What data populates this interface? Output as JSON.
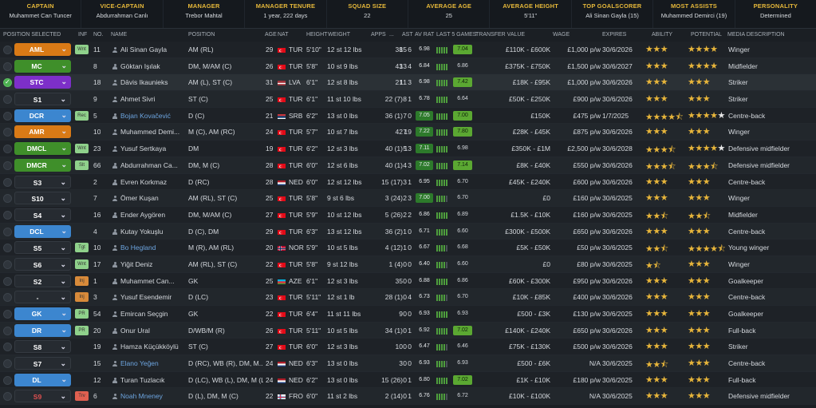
{
  "header": [
    {
      "label": "CAPTAIN",
      "value": "Muhammet Can Tuncer"
    },
    {
      "label": "VICE-CAPTAIN",
      "value": "Abdurrahman Canlı"
    },
    {
      "label": "MANAGER",
      "value": "Trebor Mahtal"
    },
    {
      "label": "MANAGER TENURE",
      "value": "1 year, 222 days"
    },
    {
      "label": "SQUAD SIZE",
      "value": "22"
    },
    {
      "label": "AVERAGE AGE",
      "value": "25"
    },
    {
      "label": "AVERAGE HEIGHT",
      "value": "5'11\""
    },
    {
      "label": "TOP GOALSCORER",
      "value": "Ali Sinan Gayla (15)"
    },
    {
      "label": "MOST ASSISTS",
      "value": "Muhammed Demirci (19)"
    },
    {
      "label": "PERSONALITY",
      "value": "Determined"
    }
  ],
  "columns": {
    "position_selected": "POSITION SELECTED",
    "inf": "INF",
    "no": "NO.",
    "name": "NAME",
    "position": "POSITION",
    "age": "AGE",
    "nat": "NAT",
    "height": "HEIGHT",
    "weight": "WEIGHT",
    "apps": "APPS",
    "gls": "...",
    "ast": "AST",
    "av_rat": "AV RAT",
    "last5": "LAST 5 GAMES",
    "transfer_value": "TRANSFER VALUE",
    "wage": "WAGE",
    "expires": "EXPIRES",
    "ability": "ABILITY",
    "potential": "POTENTIAL",
    "media": "MEDIA DESCRIPTION"
  },
  "colors": {
    "orange": "#d97a16",
    "green": "#3f8f2a",
    "purple": "#7d2fc9",
    "blue": "#3c86cf",
    "gray": "#262b31",
    "star": "#e7b53b"
  },
  "players": [
    {
      "sel": "AML",
      "pc": "orange",
      "inf": "Wnt",
      "infc": "#8fd18b",
      "no": "11",
      "name": "Ali Sinan Gayla",
      "blue": false,
      "pos": "AM (RL)",
      "age": "29",
      "flag": "tr",
      "nat": "TUR",
      "h": "5'10\"",
      "w": "12 st 12 lbs",
      "apps": "38",
      "gls": "15",
      "ast": "6",
      "avr": "6.98",
      "avg": false,
      "bars": 5,
      "l5": "7.04",
      "l5g": true,
      "tv": "£110K - £600K",
      "wage": "£1,000 p/w",
      "exp": "30/6/2026",
      "ab": 3,
      "abh": 0,
      "po": 4,
      "poh": 0,
      "pow": 0,
      "media": "Winger",
      "check": false
    },
    {
      "sel": "MC",
      "pc": "green",
      "inf": "",
      "infc": "",
      "no": "8",
      "name": "Göktan Işılak",
      "blue": false,
      "pos": "DM, M/AM (C)",
      "age": "26",
      "flag": "tr",
      "nat": "TUR",
      "h": "5'8\"",
      "w": "10 st 9 lbs",
      "apps": "43",
      "gls": "13",
      "ast": "4",
      "avr": "6.84",
      "avg": false,
      "bars": 5,
      "l5": "6.86",
      "l5g": false,
      "tv": "£375K - £750K",
      "wage": "£1,500 p/w",
      "exp": "30/6/2027",
      "ab": 3,
      "abh": 0,
      "po": 4,
      "poh": 0,
      "pow": 0,
      "media": "Midfielder",
      "check": false
    },
    {
      "sel": "STC",
      "pc": "purple",
      "inf": "",
      "infc": "",
      "no": "18",
      "name": "Dāvis Ikaunieks",
      "blue": false,
      "pos": "AM (L), ST (C)",
      "age": "31",
      "flag": "lv",
      "nat": "LVA",
      "h": "6'1\"",
      "w": "12 st 8 lbs",
      "apps": "21",
      "gls": "11",
      "ast": "3",
      "avr": "6.98",
      "avg": false,
      "bars": 5,
      "l5": "7.42",
      "l5g": true,
      "tv": "£18K - £95K",
      "wage": "£1,000 p/w",
      "exp": "30/6/2026",
      "ab": 3,
      "abh": 0,
      "po": 3,
      "poh": 0,
      "pow": 0,
      "media": "Striker",
      "check": true
    },
    {
      "sel": "S1",
      "pc": "gray",
      "inf": "",
      "infc": "",
      "no": "9",
      "name": "Ahmet Sivri",
      "blue": false,
      "pos": "ST (C)",
      "age": "25",
      "flag": "tr",
      "nat": "TUR",
      "h": "6'1\"",
      "w": "11 st 10 lbs",
      "apps": "22 (7)",
      "gls": "8",
      "ast": "1",
      "avr": "6.78",
      "avg": false,
      "bars": 5,
      "l5": "6.64",
      "l5g": false,
      "tv": "£50K - £250K",
      "wage": "£900 p/w",
      "exp": "30/6/2026",
      "ab": 3,
      "abh": 0,
      "po": 3,
      "poh": 0,
      "pow": 0,
      "media": "Striker",
      "check": false
    },
    {
      "sel": "DCR",
      "pc": "blue",
      "inf": "Rec",
      "infc": "#8fd18b",
      "no": "5",
      "name": "Bojan Kovačević",
      "blue": true,
      "pos": "D (C)",
      "age": "21",
      "flag": "rs",
      "nat": "SRB",
      "h": "6'2\"",
      "w": "13 st 0 lbs",
      "apps": "36 (1)",
      "gls": "7",
      "ast": "0",
      "avr": "7.05",
      "avg": true,
      "bars": 5,
      "l5": "7.00",
      "l5g": true,
      "tv": "£150K",
      "wage": "£475 p/w",
      "exp": "1/7/2025",
      "ab": 4,
      "abh": 1,
      "po": 4,
      "poh": 0,
      "pow": 1,
      "media": "Centre-back",
      "check": false
    },
    {
      "sel": "AMR",
      "pc": "orange",
      "inf": "",
      "infc": "",
      "no": "10",
      "name": "Muhammed Demi...",
      "blue": false,
      "pos": "M (C), AM (RC)",
      "age": "24",
      "flag": "tr",
      "nat": "TUR",
      "h": "5'7\"",
      "w": "10 st 7 lbs",
      "apps": "42",
      "gls": "7",
      "ast": "19",
      "avr": "7.22",
      "avg": true,
      "bars": 5,
      "l5": "7.80",
      "l5g": true,
      "tv": "£28K - £45K",
      "wage": "£875 p/w",
      "exp": "30/6/2026",
      "ab": 3,
      "abh": 0,
      "po": 3,
      "poh": 0,
      "pow": 0,
      "media": "Winger",
      "check": false
    },
    {
      "sel": "DMCL",
      "pc": "green",
      "inf": "Wnt",
      "infc": "#8fd18b",
      "no": "23",
      "name": "Yusuf Sertkaya",
      "blue": false,
      "pos": "DM",
      "age": "19",
      "flag": "tr",
      "nat": "TUR",
      "h": "6'2\"",
      "w": "12 st 3 lbs",
      "apps": "40 (1)",
      "gls": "5",
      "ast": "13",
      "avr": "7.11",
      "avg": true,
      "bars": 5,
      "l5": "6.98",
      "l5g": false,
      "tv": "£350K - £1M",
      "wage": "£2,500 p/w",
      "exp": "30/6/2028",
      "ab": 3,
      "abh": 1,
      "po": 4,
      "poh": 0,
      "pow": 1,
      "media": "Defensive midfielder",
      "check": false
    },
    {
      "sel": "DMCR",
      "pc": "green",
      "inf": "Slt",
      "infc": "#8fd18b",
      "no": "66",
      "name": "Abdurrahman Ca...",
      "blue": false,
      "pos": "DM, M (C)",
      "age": "28",
      "flag": "tr",
      "nat": "TUR",
      "h": "6'0\"",
      "w": "12 st 6 lbs",
      "apps": "40 (1)",
      "gls": "4",
      "ast": "3",
      "avr": "7.02",
      "avg": true,
      "bars": 5,
      "l5": "7.14",
      "l5g": true,
      "tv": "£8K - £40K",
      "wage": "£550 p/w",
      "exp": "30/6/2026",
      "ab": 3,
      "abh": 1,
      "po": 3,
      "poh": 1,
      "pow": 0,
      "media": "Defensive midfielder",
      "check": false
    },
    {
      "sel": "S3",
      "pc": "gray",
      "inf": "",
      "infc": "",
      "no": "2",
      "name": "Evren Korkmaz",
      "blue": false,
      "pos": "D (RC)",
      "age": "28",
      "flag": "nl",
      "nat": "NED",
      "h": "6'0\"",
      "w": "12 st 12 lbs",
      "apps": "15 (17)",
      "gls": "3",
      "ast": "1",
      "avr": "6.95",
      "avg": false,
      "bars": 5,
      "l5": "6.70",
      "l5g": false,
      "tv": "£45K - £240K",
      "wage": "£600 p/w",
      "exp": "30/6/2026",
      "ab": 3,
      "abh": 0,
      "po": 3,
      "poh": 0,
      "pow": 0,
      "media": "Centre-back",
      "check": false
    },
    {
      "sel": "S10",
      "pc": "gray",
      "inf": "",
      "infc": "",
      "no": "7",
      "name": "Ömer Kuşan",
      "blue": false,
      "pos": "AM (RL), ST (C)",
      "age": "25",
      "flag": "tr",
      "nat": "TUR",
      "h": "5'8\"",
      "w": "9 st 6 lbs",
      "apps": "3 (24)",
      "gls": "2",
      "ast": "3",
      "avr": "7.00",
      "avg": true,
      "bars": 4,
      "l5": "6.70",
      "l5g": false,
      "tv": "£0",
      "wage": "£160 p/w",
      "exp": "30/6/2025",
      "ab": 3,
      "abh": 0,
      "po": 3,
      "poh": 0,
      "pow": 0,
      "media": "Winger",
      "check": false
    },
    {
      "sel": "S4",
      "pc": "gray",
      "inf": "",
      "infc": "",
      "no": "16",
      "name": "Ender Aygören",
      "blue": false,
      "pos": "DM, M/AM (C)",
      "age": "27",
      "flag": "tr",
      "nat": "TUR",
      "h": "5'9\"",
      "w": "10 st 12 lbs",
      "apps": "5 (26)",
      "gls": "2",
      "ast": "2",
      "avr": "6.86",
      "avg": false,
      "bars": 5,
      "l5": "6.89",
      "l5g": false,
      "tv": "£1.5K - £10K",
      "wage": "£160 p/w",
      "exp": "30/6/2025",
      "ab": 2,
      "abh": 1,
      "po": 2,
      "poh": 1,
      "pow": 0,
      "media": "Midfielder",
      "check": false
    },
    {
      "sel": "DCL",
      "pc": "blue",
      "inf": "",
      "infc": "",
      "no": "4",
      "name": "Kutay Yokuşlu",
      "blue": false,
      "pos": "D (C), DM",
      "age": "29",
      "flag": "tr",
      "nat": "TUR",
      "h": "6'3\"",
      "w": "13 st 12 lbs",
      "apps": "36 (2)",
      "gls": "1",
      "ast": "0",
      "avr": "6.71",
      "avg": false,
      "bars": 5,
      "l5": "6.60",
      "l5g": false,
      "tv": "£300K - £500K",
      "wage": "£650 p/w",
      "exp": "30/6/2026",
      "ab": 3,
      "abh": 0,
      "po": 3,
      "poh": 0,
      "pow": 0,
      "media": "Centre-back",
      "check": false
    },
    {
      "sel": "S5",
      "pc": "gray",
      "inf": "Tgt",
      "infc": "#8fd18b",
      "no": "10",
      "name": "Bo Hegland",
      "blue": true,
      "pos": "M (R), AM (RL)",
      "age": "20",
      "flag": "no",
      "nat": "NOR",
      "h": "5'9\"",
      "w": "10 st 5 lbs",
      "apps": "4 (12)",
      "gls": "1",
      "ast": "0",
      "avr": "6.67",
      "avg": false,
      "bars": 4,
      "l5": "6.68",
      "l5g": false,
      "tv": "£5K - £50K",
      "wage": "£50 p/w",
      "exp": "30/6/2025",
      "ab": 2,
      "abh": 1,
      "po": 4,
      "poh": 1,
      "pow": 0,
      "media": "Young winger",
      "check": false
    },
    {
      "sel": "S6",
      "pc": "gray",
      "inf": "Wnt",
      "infc": "#8fd18b",
      "no": "17",
      "name": "Yiğit Deniz",
      "blue": false,
      "pos": "AM (RL), ST (C)",
      "age": "22",
      "flag": "tr",
      "nat": "TUR",
      "h": "5'8\"",
      "w": "9 st 12 lbs",
      "apps": "1 (4)",
      "gls": "0",
      "ast": "0",
      "avr": "6.40",
      "avg": false,
      "bars": 4,
      "l5": "6.60",
      "l5g": false,
      "tv": "£0",
      "wage": "£80 p/w",
      "exp": "30/6/2025",
      "ab": 1,
      "abh": 1,
      "po": 3,
      "poh": 0,
      "pow": 0,
      "media": "Winger",
      "check": false
    },
    {
      "sel": "S2",
      "pc": "gray",
      "inf": "Inj",
      "infc": "#d88a3a",
      "no": "1",
      "name": "Muhammet Can...",
      "blue": false,
      "pos": "GK",
      "age": "25",
      "flag": "az",
      "nat": "AZE",
      "h": "6'1\"",
      "w": "12 st 3 lbs",
      "apps": "35",
      "gls": "0",
      "ast": "0",
      "avr": "6.88",
      "avg": false,
      "bars": 5,
      "l5": "6.86",
      "l5g": false,
      "tv": "£60K - £300K",
      "wage": "£950 p/w",
      "exp": "30/6/2026",
      "ab": 3,
      "abh": 0,
      "po": 3,
      "poh": 0,
      "pow": 0,
      "media": "Goalkeeper",
      "check": false
    },
    {
      "sel": "-",
      "pc": "gray",
      "inf": "Inj",
      "infc": "#d88a3a",
      "no": "3",
      "name": "Yusuf Esendemir",
      "blue": false,
      "pos": "D (LC)",
      "age": "23",
      "flag": "tr",
      "nat": "TUR",
      "h": "5'11\"",
      "w": "12 st 1 lb",
      "apps": "28 (1)",
      "gls": "0",
      "ast": "4",
      "avr": "6.73",
      "avg": false,
      "bars": 4,
      "l5": "6.70",
      "l5g": false,
      "tv": "£10K - £85K",
      "wage": "£400 p/w",
      "exp": "30/6/2026",
      "ab": 3,
      "abh": 0,
      "po": 3,
      "poh": 0,
      "pow": 0,
      "media": "Centre-back",
      "check": false
    },
    {
      "sel": "GK",
      "pc": "blue",
      "inf": "PR",
      "infc": "#8fd18b",
      "no": "54",
      "name": "Emircan Seçgin",
      "blue": false,
      "pos": "GK",
      "age": "22",
      "flag": "tr",
      "nat": "TUR",
      "h": "6'4\"",
      "w": "11 st 11 lbs",
      "apps": "9",
      "gls": "0",
      "ast": "0",
      "avr": "6.93",
      "avg": false,
      "bars": 5,
      "l5": "6.93",
      "l5g": false,
      "tv": "£500 - £3K",
      "wage": "£130 p/w",
      "exp": "30/6/2025",
      "ab": 3,
      "abh": 0,
      "po": 3,
      "poh": 0,
      "pow": 0,
      "media": "Goalkeeper",
      "check": false
    },
    {
      "sel": "DR",
      "pc": "blue",
      "inf": "PR",
      "infc": "#8fd18b",
      "no": "20",
      "name": "Onur Ural",
      "blue": false,
      "pos": "D/WB/M (R)",
      "age": "26",
      "flag": "tr",
      "nat": "TUR",
      "h": "5'11\"",
      "w": "10 st 5 lbs",
      "apps": "34 (1)",
      "gls": "0",
      "ast": "1",
      "avr": "6.92",
      "avg": false,
      "bars": 5,
      "l5": "7.02",
      "l5g": true,
      "tv": "£140K - £240K",
      "wage": "£650 p/w",
      "exp": "30/6/2026",
      "ab": 3,
      "abh": 0,
      "po": 3,
      "poh": 0,
      "pow": 0,
      "media": "Full-back",
      "check": false
    },
    {
      "sel": "S8",
      "pc": "gray",
      "inf": "",
      "infc": "",
      "no": "19",
      "name": "Hamza Küçükköylü",
      "blue": false,
      "pos": "ST (C)",
      "age": "27",
      "flag": "tr",
      "nat": "TUR",
      "h": "6'0\"",
      "w": "12 st 3 lbs",
      "apps": "10",
      "gls": "0",
      "ast": "0",
      "avr": "6.47",
      "avg": false,
      "bars": 4,
      "l5": "6.46",
      "l5g": false,
      "tv": "£75K - £130K",
      "wage": "£500 p/w",
      "exp": "30/6/2026",
      "ab": 3,
      "abh": 0,
      "po": 3,
      "poh": 0,
      "pow": 0,
      "media": "Striker",
      "check": false
    },
    {
      "sel": "S7",
      "pc": "gray",
      "inf": "",
      "infc": "",
      "no": "15",
      "name": "Elano Yeğen",
      "blue": true,
      "pos": "D (RC), WB (R), DM, M...",
      "age": "24",
      "flag": "nl",
      "nat": "NED",
      "h": "6'3\"",
      "w": "13 st 0 lbs",
      "apps": "3",
      "gls": "0",
      "ast": "0",
      "avr": "6.93",
      "avg": false,
      "bars": 4,
      "l5": "6.93",
      "l5g": false,
      "tv": "£500 - £6K",
      "wage": "N/A",
      "exp": "30/6/2025",
      "ab": 2,
      "abh": 1,
      "po": 3,
      "poh": 0,
      "pow": 0,
      "media": "Centre-back",
      "check": false
    },
    {
      "sel": "DL",
      "pc": "blue",
      "inf": "",
      "infc": "",
      "no": "12",
      "name": "Turan Tuzlacık",
      "blue": false,
      "pos": "D (LC), WB (L), DM, M (L)",
      "age": "24",
      "flag": "nl",
      "nat": "NED",
      "h": "6'2\"",
      "w": "13 st 0 lbs",
      "apps": "15 (26)",
      "gls": "0",
      "ast": "1",
      "avr": "6.80",
      "avg": false,
      "bars": 5,
      "l5": "7.02",
      "l5g": true,
      "tv": "£1K - £10K",
      "wage": "£180 p/w",
      "exp": "30/6/2025",
      "ab": 3,
      "abh": 0,
      "po": 3,
      "poh": 0,
      "pow": 0,
      "media": "Full-back",
      "check": false
    },
    {
      "sel": "S9",
      "pc": "gray",
      "selred": true,
      "inf": "Trv",
      "infc": "#e06050",
      "no": "6",
      "name": "Noah Mneney",
      "blue": true,
      "pos": "D (L), DM, M (C)",
      "age": "22",
      "flag": "fo",
      "nat": "FRO",
      "h": "6'0\"",
      "w": "11 st 2 lbs",
      "apps": "2 (14)",
      "gls": "0",
      "ast": "1",
      "avr": "6.76",
      "avg": false,
      "bars": 4,
      "l5": "6.72",
      "l5g": false,
      "tv": "£10K - £100K",
      "wage": "N/A",
      "exp": "30/6/2025",
      "ab": 3,
      "abh": 0,
      "po": 3,
      "poh": 0,
      "pow": 0,
      "media": "Defensive midfielder",
      "check": false
    }
  ]
}
